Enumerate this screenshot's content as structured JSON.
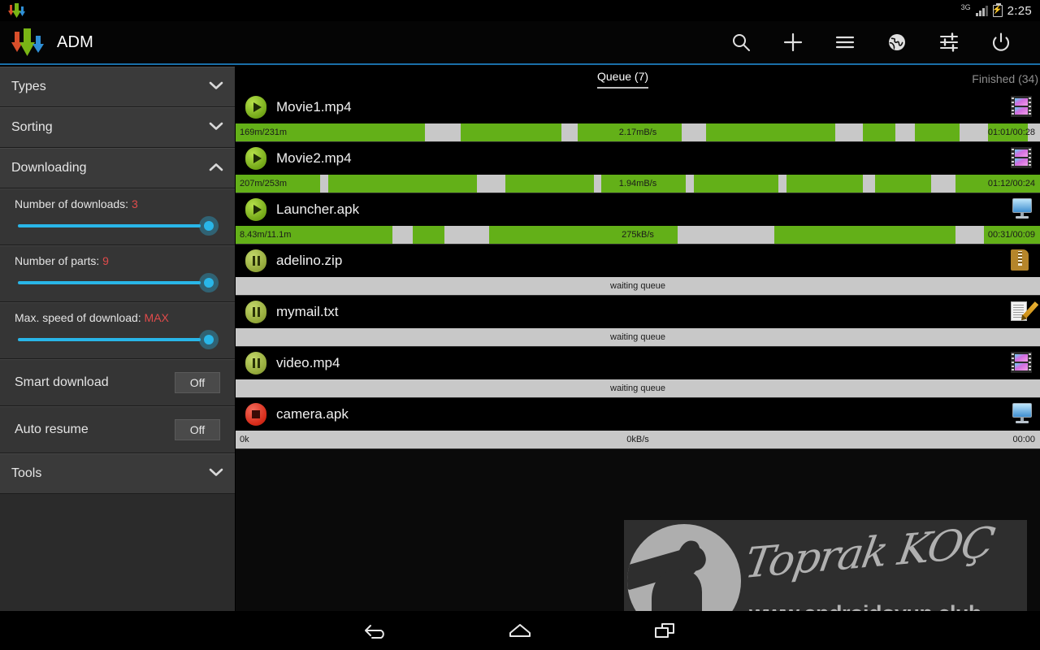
{
  "status_bar": {
    "network_label": "3G",
    "time": "2:25",
    "battery_icon": "battery-charging-icon",
    "signal_icon": "signal-bars-icon",
    "app_icon": "adm-notification-icon"
  },
  "action_bar": {
    "title": "ADM",
    "logo_icon": "adm-logo-icon",
    "accent_color": "#1a6fa8",
    "buttons": [
      {
        "name": "search-button",
        "icon": "search-icon"
      },
      {
        "name": "add-download-button",
        "icon": "plus-icon"
      },
      {
        "name": "menu-button",
        "icon": "hamburger-menu-icon"
      },
      {
        "name": "browser-button",
        "icon": "globe-icon"
      },
      {
        "name": "settings-button",
        "icon": "sliders-icon"
      },
      {
        "name": "power-button",
        "icon": "power-icon"
      }
    ]
  },
  "sidebar": {
    "sections": [
      {
        "label": "Types",
        "state": "collapsed",
        "chevron": "chevron-down-icon"
      },
      {
        "label": "Sorting",
        "state": "collapsed",
        "chevron": "chevron-down-icon"
      },
      {
        "label": "Downloading",
        "state": "expanded",
        "chevron": "chevron-up-icon"
      },
      {
        "label": "Tools",
        "state": "collapsed",
        "chevron": "chevron-down-icon"
      }
    ],
    "sliders": [
      {
        "label": "Number of downloads:",
        "value": "3",
        "percent": 100
      },
      {
        "label": "Number of parts:",
        "value": "9",
        "percent": 100
      },
      {
        "label": "Max. speed of download:",
        "value": "MAX",
        "percent": 100
      }
    ],
    "toggles": [
      {
        "label": "Smart download",
        "value": "Off"
      },
      {
        "label": "Auto resume",
        "value": "Off"
      }
    ],
    "value_color": "#e04b4b",
    "slider_color": "#29b6e8"
  },
  "tabs": {
    "active": "Queue (7)",
    "inactive": "Finished (34)"
  },
  "downloads": [
    {
      "name": "Movie1.mp4",
      "state": "downloading",
      "control_icon": "play-icon",
      "file_icon": "film-icon",
      "progress_left": "169m/231m",
      "progress_mid": "2.17mB/s",
      "progress_right": "01:01/00:28",
      "segments": [
        23.5,
        4.5,
        12.5,
        2.0,
        13.0,
        3.0,
        16.0,
        3.5,
        4.0,
        2.5,
        5.5,
        3.5,
        5.0,
        1.5,
        0.0
      ]
    },
    {
      "name": "Movie2.mp4",
      "state": "downloading",
      "control_icon": "play-icon",
      "file_icon": "film-icon",
      "progress_left": "207m/253m",
      "progress_mid": "1.94mB/s",
      "progress_right": "01:12/00:24",
      "segments": [
        10.5,
        1.0,
        18.5,
        3.5,
        11.0,
        1.0,
        10.5,
        1.0,
        10.5,
        1.0,
        9.5,
        1.5,
        7.0,
        3.0,
        10.5
      ]
    },
    {
      "name": "Launcher.apk",
      "state": "downloading",
      "control_icon": "play-icon",
      "file_icon": "monitor-icon",
      "progress_left": "8.43m/11.1m",
      "progress_mid": "275kB/s",
      "progress_right": "00:31/00:09",
      "segments": [
        19.5,
        2.5,
        4.0,
        5.5,
        23.5,
        12.0,
        22.5,
        3.5,
        7.0,
        0.0
      ]
    },
    {
      "name": "adelino.zip",
      "state": "waiting",
      "control_icon": "pause-icon",
      "file_icon": "zip-icon",
      "status_text": "waiting queue"
    },
    {
      "name": "mymail.txt",
      "state": "waiting",
      "control_icon": "pause-icon",
      "file_icon": "text-document-icon",
      "status_text": "waiting queue"
    },
    {
      "name": "video.mp4",
      "state": "waiting",
      "control_icon": "pause-icon",
      "file_icon": "film-icon",
      "status_text": "waiting queue"
    },
    {
      "name": "camera.apk",
      "state": "stopped",
      "control_icon": "stop-icon",
      "file_icon": "monitor-icon",
      "progress_left": "0k",
      "progress_mid": "0kB/s",
      "progress_right": "00:00",
      "segments": []
    }
  ],
  "watermark": {
    "signature": "Toprak KOÇ",
    "url": "www.androidoyun.club",
    "logo_icon": "wolf-head-icon"
  },
  "nav_bar": {
    "buttons": [
      {
        "name": "nav-back-button",
        "icon": "back-arrow-icon"
      },
      {
        "name": "nav-home-button",
        "icon": "home-icon"
      },
      {
        "name": "nav-recents-button",
        "icon": "recents-icon"
      }
    ]
  }
}
